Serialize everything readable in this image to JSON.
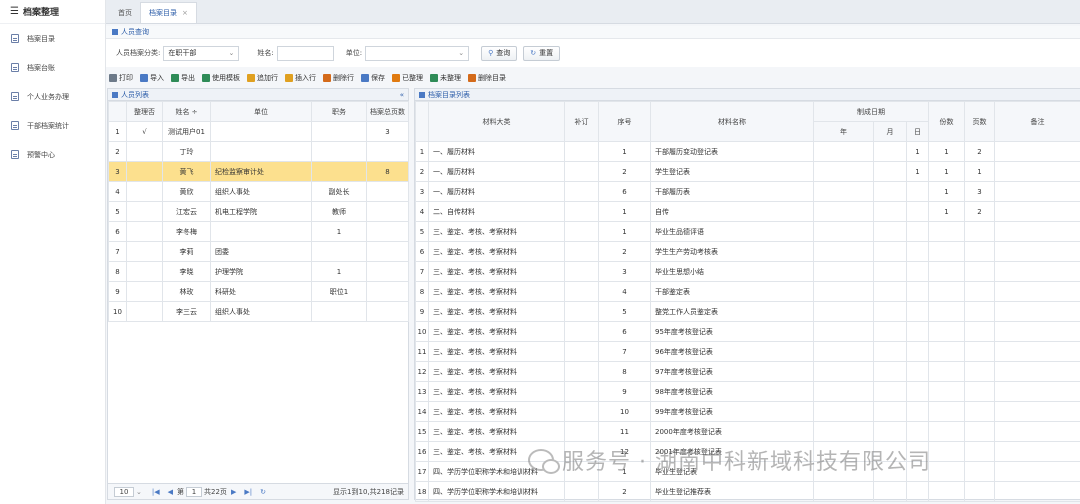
{
  "sidebar": {
    "title": "档案整理",
    "items": [
      {
        "label": "档案目录"
      },
      {
        "label": "档案台账"
      },
      {
        "label": "个人业务办理"
      },
      {
        "label": "干部档案统计"
      },
      {
        "label": "预警中心"
      }
    ]
  },
  "tabs": [
    {
      "label": "首页"
    },
    {
      "label": "档案目录",
      "close": "×"
    }
  ],
  "query": {
    "title": "人员查询",
    "category_label": "人员档案分类:",
    "category_value": "在职干部",
    "name_label": "姓名:",
    "unit_label": "单位:",
    "search_button": "查询",
    "reset_button": "重置"
  },
  "toolbar": [
    {
      "label": "打印",
      "color": "#6d7a89"
    },
    {
      "label": "导入",
      "color": "#4a79c4"
    },
    {
      "label": "导出",
      "color": "#2e8b57"
    },
    {
      "label": "使用模板",
      "color": "#2e8b57"
    },
    {
      "label": "追加行",
      "color": "#e0a020"
    },
    {
      "label": "插入行",
      "color": "#e0a020"
    },
    {
      "label": "删除行",
      "color": "#d46a1a"
    },
    {
      "label": "保存",
      "color": "#4a79c4"
    },
    {
      "label": "已整理",
      "color": "#e07a10"
    },
    {
      "label": "未整理",
      "color": "#2e8b57"
    },
    {
      "label": "删除目录",
      "color": "#d46a1a"
    }
  ],
  "left_panel": {
    "title": "人员列表",
    "collapse": "«",
    "headers": [
      "",
      "整理否",
      "姓名 ÷",
      "单位",
      "职务",
      "档案总页数"
    ],
    "rows": [
      [
        "1",
        "√",
        "测试用户01",
        "",
        "",
        "3"
      ],
      [
        "2",
        "",
        "丁玲",
        "",
        "",
        ""
      ],
      [
        "3",
        "",
        "黄飞",
        "纪检监察审计处",
        "",
        "8"
      ],
      [
        "4",
        "",
        "黄欣",
        "组织人事处",
        "副处长",
        ""
      ],
      [
        "5",
        "",
        "江宏云",
        "机电工程学院",
        "教师",
        ""
      ],
      [
        "6",
        "",
        "李冬梅",
        "",
        "1",
        ""
      ],
      [
        "7",
        "",
        "李莉",
        "团委",
        "",
        ""
      ],
      [
        "8",
        "",
        "李晓",
        "护理学院",
        "1",
        ""
      ],
      [
        "9",
        "",
        "林玫",
        "科研处",
        "职位1",
        ""
      ],
      [
        "10",
        "",
        "李三云",
        "组织人事处",
        "",
        ""
      ]
    ],
    "highlight_row": 2,
    "pager": {
      "page_size": "10",
      "page_prefix": "第",
      "page_value": "1",
      "page_total": "共22页",
      "summary": "显示1到10,共218记录"
    }
  },
  "right_panel": {
    "title": "档案目录列表",
    "headers": {
      "category": "材料大类",
      "supplement": "补订",
      "seq": "序号",
      "name": "材料名称",
      "date": "制成日期",
      "year": "年",
      "month": "月",
      "day": "日",
      "copies": "份数",
      "pages": "页数",
      "remark": "备注"
    },
    "rows": [
      [
        "1",
        "一、履历材料",
        "",
        "1",
        "干部履历变动登记表",
        "",
        "",
        "1",
        "1",
        "2",
        ""
      ],
      [
        "2",
        "一、履历材料",
        "",
        "2",
        "学生登记表",
        "",
        "",
        "1",
        "1",
        "1",
        ""
      ],
      [
        "3",
        "一、履历材料",
        "",
        "6",
        "干部履历表",
        "",
        "",
        "",
        "1",
        "3",
        ""
      ],
      [
        "4",
        "二、自传材料",
        "",
        "1",
        "自传",
        "",
        "",
        "",
        "1",
        "2",
        ""
      ],
      [
        "5",
        "三、鉴定、考核、考察材料",
        "",
        "1",
        "毕业生品德评语",
        "",
        "",
        "",
        "",
        "",
        ""
      ],
      [
        "6",
        "三、鉴定、考核、考察材料",
        "",
        "2",
        "学生生产劳动考核表",
        "",
        "",
        "",
        "",
        "",
        ""
      ],
      [
        "7",
        "三、鉴定、考核、考察材料",
        "",
        "3",
        "毕业生思想小结",
        "",
        "",
        "",
        "",
        "",
        ""
      ],
      [
        "8",
        "三、鉴定、考核、考察材料",
        "",
        "4",
        "干部鉴定表",
        "",
        "",
        "",
        "",
        "",
        ""
      ],
      [
        "9",
        "三、鉴定、考核、考察材料",
        "",
        "5",
        "整党工作人员鉴定表",
        "",
        "",
        "",
        "",
        "",
        ""
      ],
      [
        "10",
        "三、鉴定、考核、考察材料",
        "",
        "6",
        "95年度考核登记表",
        "",
        "",
        "",
        "",
        "",
        ""
      ],
      [
        "11",
        "三、鉴定、考核、考察材料",
        "",
        "7",
        "96年度考核登记表",
        "",
        "",
        "",
        "",
        "",
        ""
      ],
      [
        "12",
        "三、鉴定、考核、考察材料",
        "",
        "8",
        "97年度考核登记表",
        "",
        "",
        "",
        "",
        "",
        ""
      ],
      [
        "13",
        "三、鉴定、考核、考察材料",
        "",
        "9",
        "98年度考核登记表",
        "",
        "",
        "",
        "",
        "",
        ""
      ],
      [
        "14",
        "三、鉴定、考核、考察材料",
        "",
        "10",
        "99年度考核登记表",
        "",
        "",
        "",
        "",
        "",
        ""
      ],
      [
        "15",
        "三、鉴定、考核、考察材料",
        "",
        "11",
        "2000年度考核登记表",
        "",
        "",
        "",
        "",
        "",
        ""
      ],
      [
        "16",
        "三、鉴定、考核、考察材料",
        "",
        "12",
        "2001年度考核登记表",
        "",
        "",
        "",
        "",
        "",
        ""
      ],
      [
        "17",
        "四、学历学位职称学术和培训材料",
        "",
        "1",
        "毕业生登记表",
        "",
        "",
        "",
        "",
        "",
        ""
      ],
      [
        "18",
        "四、学历学位职称学术和培训材料",
        "",
        "2",
        "毕业生登记推荐表",
        "",
        "",
        "",
        "",
        "",
        ""
      ]
    ]
  },
  "watermark": {
    "text": "服务号 · 湖南中科新域科技有限公司"
  }
}
